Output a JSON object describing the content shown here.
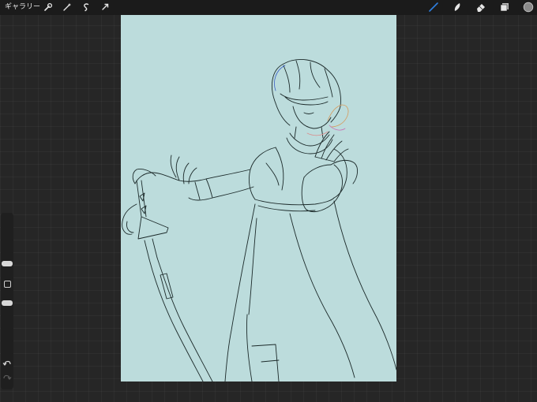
{
  "topbar": {
    "gallery_label": "ギャラリー",
    "left_tools": [
      "wrench-icon",
      "magic-wand-icon",
      "selection-icon",
      "transform-arrow-icon"
    ],
    "right_tools": [
      "brush-icon",
      "smudge-icon",
      "eraser-icon",
      "layers-icon",
      "color-swatch-icon"
    ]
  },
  "colors": {
    "background": "#262626",
    "topbar": "#1b1b1b",
    "canvas": "#bcdcdc",
    "active_tool": "#2f7fe0",
    "tool_inactive": "#e6e6e6",
    "current_color": "#8a8a8a",
    "line_art": "#1c2a2a"
  },
  "sidebar": {
    "brush_size_level": 0.17,
    "opacity_level": 0.5,
    "items": [
      "brush-size-slider",
      "modify-button",
      "opacity-slider",
      "undo-button",
      "redo-button"
    ]
  }
}
